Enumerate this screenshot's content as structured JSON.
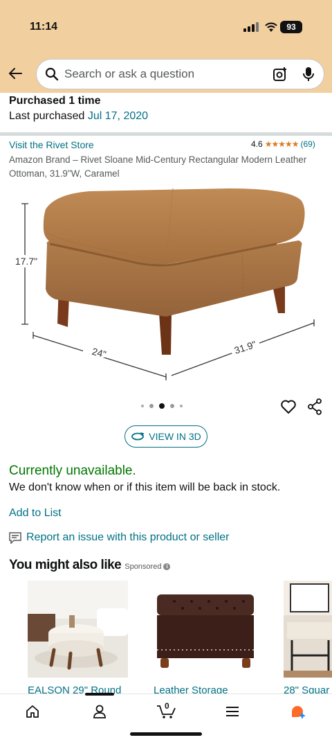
{
  "status_bar": {
    "time": "11:14",
    "battery": "93"
  },
  "search": {
    "placeholder": "Search or ask a question"
  },
  "purchase": {
    "times": "Purchased 1 time",
    "last_prefix": "Last purchased ",
    "last_date": "Jul 17, 2020"
  },
  "product": {
    "store_link": "Visit the Rivet Store",
    "rating": "4.6",
    "stars": "★★★★★",
    "review_count": "(69)",
    "title": "Amazon Brand – Rivet Sloane Mid-Century Rectangular Modern Leather Ottoman, 31.9\"W, Caramel",
    "dim_height": "17.7\"",
    "dim_depth": "24\"",
    "dim_width": "31.9\"",
    "image_index": 3,
    "image_count": 5
  },
  "view3d_label": "VIEW IN 3D",
  "availability": {
    "status": "Currently unavailable.",
    "detail": "We don't know when or if this item will be back in stock."
  },
  "add_to_list": "Add to List",
  "report": "Report an issue with this product or seller",
  "recommendations": {
    "heading": "You might also like",
    "sponsored": "Sponsored",
    "items": [
      {
        "label": "EALSON 29\" Round"
      },
      {
        "label": "Leather Storage"
      },
      {
        "label": "28\" Squar"
      }
    ]
  },
  "bottom_nav": {
    "cart_count": "0"
  },
  "colors": {
    "header": "#f2cf9f",
    "link": "#007185",
    "available": "#007600",
    "star": "#de7921"
  }
}
